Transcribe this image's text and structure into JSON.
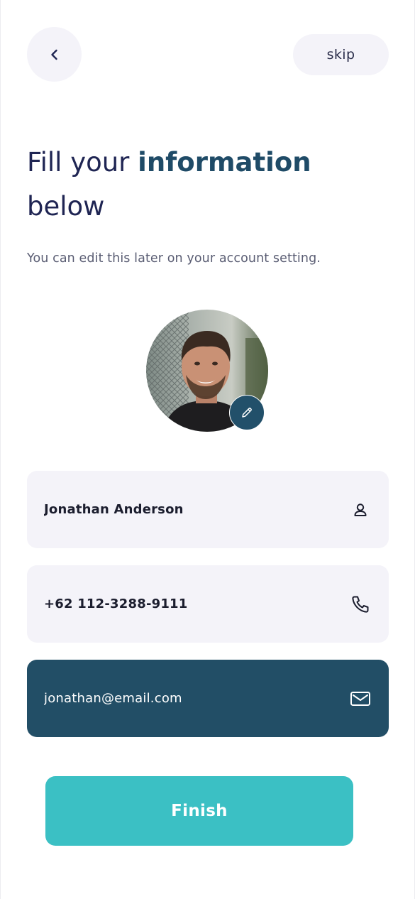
{
  "header": {
    "skip_label": "skip"
  },
  "heading": {
    "title_prefix": "Fill your ",
    "title_highlight": "information",
    "title_suffix": "below",
    "subtitle": "You can edit this later on your account setting."
  },
  "form": {
    "name_value": "Jonathan Anderson",
    "phone_value": "+62 112-3288-9111",
    "email_value": "jonathan@email.com"
  },
  "actions": {
    "finish_label": "Finish"
  },
  "colors": {
    "accent": "#1f4b67",
    "active_field": "#224e66",
    "finish_button": "#3bc0c4",
    "field_background": "#f4f3f9"
  },
  "icons": {
    "back": "chevron-left-icon",
    "edit": "pencil-icon",
    "name": "user-icon",
    "phone": "phone-icon",
    "email": "mail-icon"
  }
}
